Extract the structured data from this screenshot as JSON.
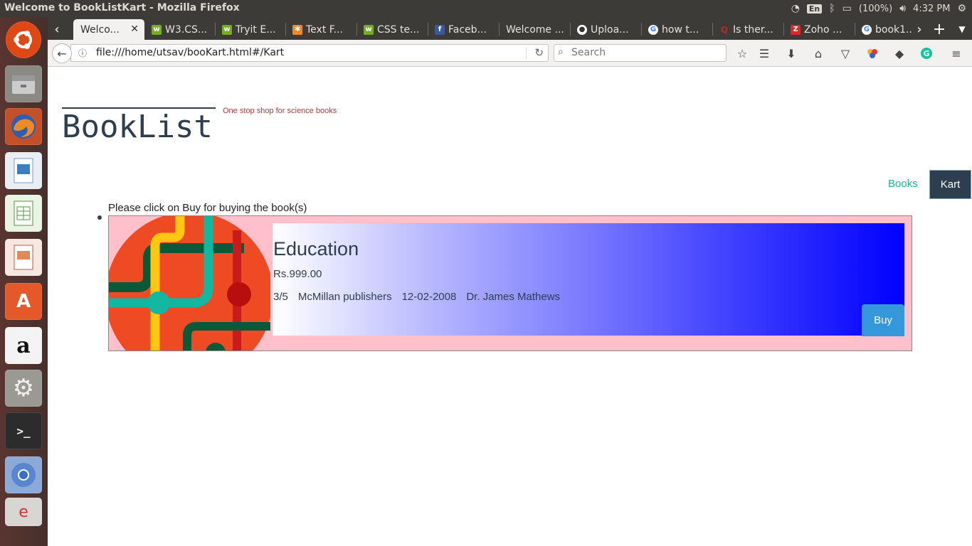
{
  "window": {
    "title": "Welcome to BookListKart - Mozilla Firefox"
  },
  "tray": {
    "keyboard": "En",
    "battery": "(100%)",
    "time": "4:32 PM"
  },
  "tabs": [
    {
      "label": "Welco...",
      "icon": "ubuntu-icon",
      "active": true
    },
    {
      "label": "W3.CS...",
      "icon": "w3-icon"
    },
    {
      "label": "Tryit E...",
      "icon": "w3-icon"
    },
    {
      "label": "Text F...",
      "icon": "asterisk-icon"
    },
    {
      "label": "CSS te...",
      "icon": "w3-icon"
    },
    {
      "label": "Faceb...",
      "icon": "facebook-icon"
    },
    {
      "label": "Welcome ...",
      "icon": "none"
    },
    {
      "label": "Uploa...",
      "icon": "github-icon"
    },
    {
      "label": "how t...",
      "icon": "google-icon"
    },
    {
      "label": "Is ther...",
      "icon": "quora-icon"
    },
    {
      "label": "Zoho ...",
      "icon": "zoho-icon"
    },
    {
      "label": "book1...",
      "icon": "google-icon"
    }
  ],
  "navbar": {
    "url": "file:///home/utsav/booKart.html#/Kart",
    "search_placeholder": "Search"
  },
  "page": {
    "brand_title": "BookList",
    "tagline": "One stop shop for science books",
    "nav_books": "Books",
    "nav_kart": "Kart",
    "instruction": "Please click on Buy for buying the book(s)",
    "book": {
      "title": "Education",
      "price": "Rs.999.00",
      "rating": "3/5",
      "publisher": "McMillan publishers",
      "date": "12-02-2008",
      "author": "Dr. James Mathews",
      "buy_label": "Buy"
    }
  },
  "colors": {
    "accent_teal": "#1ab394",
    "navy": "#2d3e50",
    "buy_blue": "#3498db",
    "card_bg": "pink",
    "tagline_red": "#b03a3a"
  }
}
